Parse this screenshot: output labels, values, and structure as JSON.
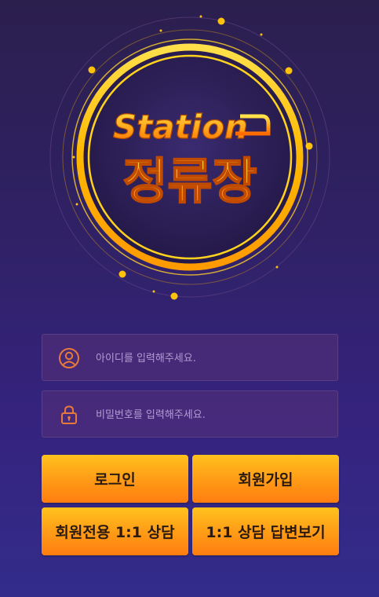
{
  "logo": {
    "title_en": "Station",
    "title_ko": "정류장"
  },
  "login_form": {
    "id_placeholder": "아이디를 입력해주세요.",
    "password_placeholder": "비밀번호를 입력해주세요."
  },
  "buttons": {
    "login": "로그인",
    "signup": "회원가입",
    "member_consult": "회원전용 1:1 상담",
    "consult_reply": "1:1 상담 답변보기"
  },
  "icons": {
    "id_field": "user-circle-icon",
    "password_field": "lock-icon"
  },
  "colors": {
    "accent": "#ff9d17",
    "ring": "#ffc400",
    "icon": "#e8793a",
    "background": "#2f2163"
  }
}
